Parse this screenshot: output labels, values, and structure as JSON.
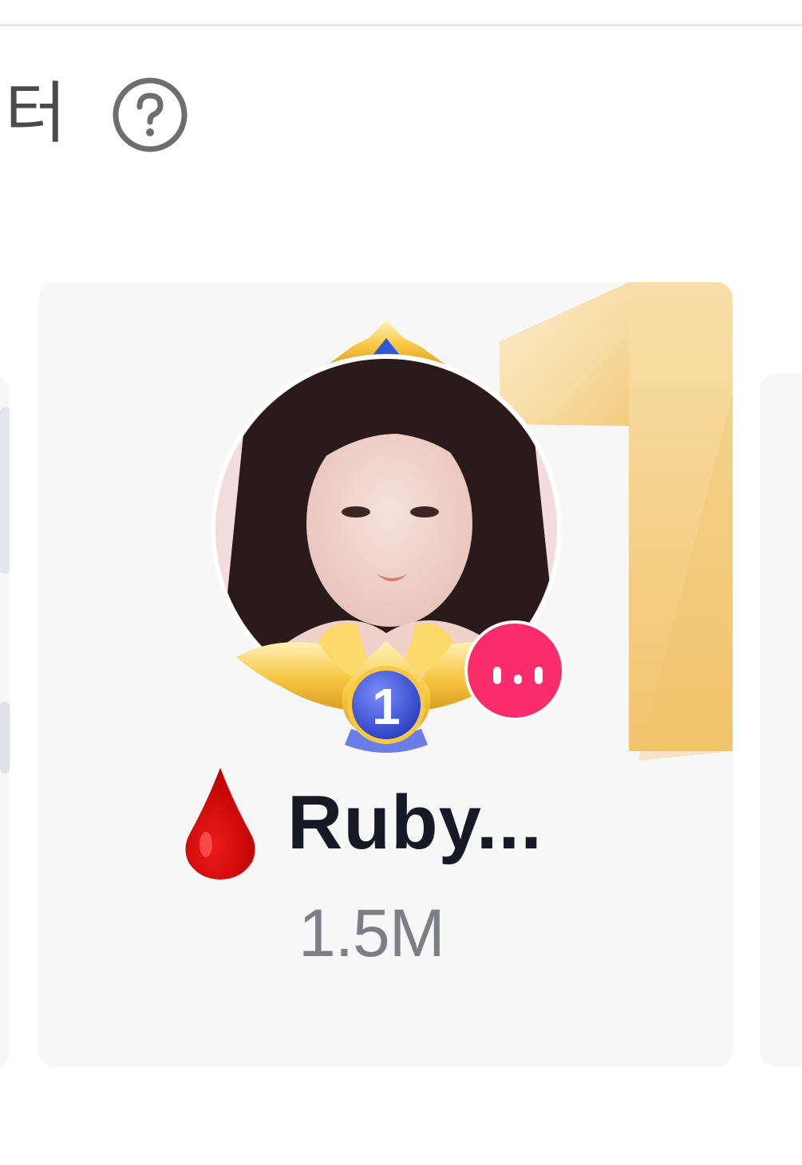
{
  "header": {
    "title_fragment": "터",
    "help_icon": "question-circle-icon"
  },
  "leaderboard": {
    "top_user": {
      "rank": "1",
      "rank_background_digit": "1",
      "badge_icon": "drop-icon",
      "name": "Ruby...",
      "score": "1.5M",
      "live_indicator_icon": "live-bars-icon"
    }
  },
  "colors": {
    "gold": "#f2c878",
    "live_pink": "#fa2c6b",
    "rank_blue": "#2f4fd6",
    "name_text": "#151a24",
    "score_text": "#7e7f86",
    "card_bg": "#f7f7f8"
  }
}
